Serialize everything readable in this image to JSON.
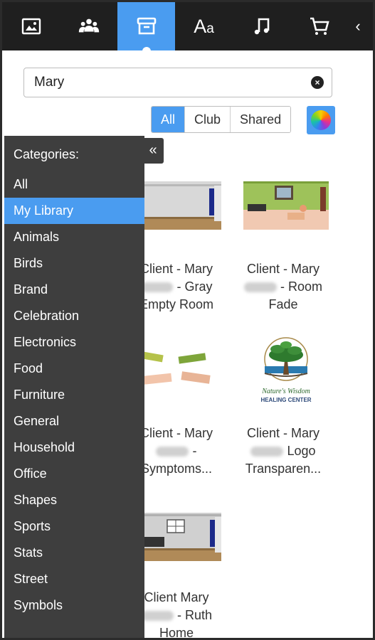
{
  "topbar": {
    "tabs": [
      {
        "name": "image-icon",
        "active": false
      },
      {
        "name": "people-icon",
        "active": false
      },
      {
        "name": "archive-box-icon",
        "active": true
      },
      {
        "name": "text-aa-icon",
        "active": false,
        "label_big": "A",
        "label_small": "a"
      },
      {
        "name": "music-note-icon",
        "active": false
      },
      {
        "name": "cart-icon",
        "active": false
      }
    ],
    "arrow": "‹"
  },
  "search": {
    "value": "Mary",
    "clear": "×"
  },
  "filters": {
    "all": "All",
    "club": "Club",
    "shared": "Shared",
    "selected": "All"
  },
  "sidebar": {
    "collapse": "«",
    "title": "Categories:",
    "items": [
      "All",
      "My Library",
      "Animals",
      "Birds",
      "Brand",
      "Celebration",
      "Electronics",
      "Food",
      "Furniture",
      "General",
      "Household",
      "Office",
      "Shapes",
      "Sports",
      "Stats",
      "Street",
      "Symbols"
    ],
    "active": "My Library"
  },
  "library": {
    "items": [
      {
        "line1": "Client - Mary",
        "line2_suffix": "- Gray",
        "line3": "Empty Room"
      },
      {
        "line1": "Client - Mary",
        "line2_suffix": "- Room",
        "line3": "Fade"
      },
      {
        "line1": "Client - Mary",
        "line2_suffix": "-",
        "line3": "Symptoms..."
      },
      {
        "line1": "Client - Mary",
        "line2_suffix": "Logo",
        "line3": "Transparen..."
      },
      {
        "line1": "Client Mary",
        "line2_suffix": "- Ruth",
        "line3": "Home"
      }
    ],
    "logo_text": {
      "script": "Nature's Wisdom",
      "caps": "HEALING CENTER"
    }
  },
  "colors": {
    "accent": "#4a9cf0",
    "topbar": "#1f1f1f",
    "sidebar": "#3e3e3e"
  }
}
